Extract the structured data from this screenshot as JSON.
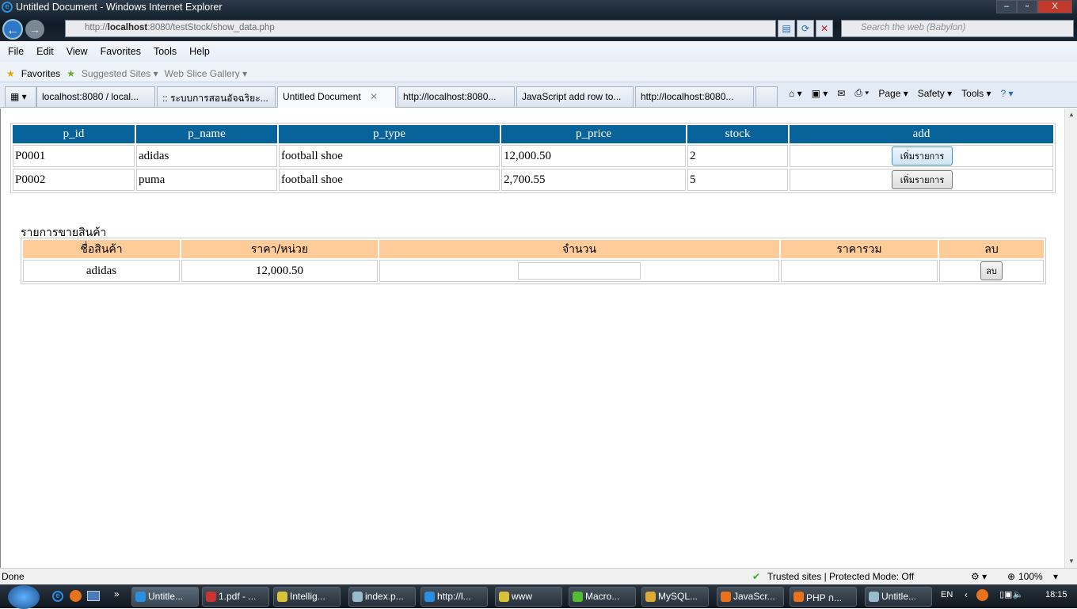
{
  "window": {
    "title": "Untitled Document - Windows Internet Explorer",
    "minimize": "–",
    "maximize": "▫",
    "close": "X"
  },
  "address": {
    "prefix": "http://",
    "host": "localhost",
    "rest": ":8080/testStock/show_data.php",
    "search_placeholder": "Search the web (Babylon)"
  },
  "menu": [
    "File",
    "Edit",
    "View",
    "Favorites",
    "Tools",
    "Help"
  ],
  "favorites": {
    "label": "Favorites",
    "suggested": "Suggested Sites ▾",
    "webslice": "Web Slice Gallery ▾"
  },
  "tabs": [
    "localhost:8080 / local...",
    ":: ระบบการสอนอัจฉริยะ...",
    "Untitled Document",
    "http://localhost:8080...",
    "JavaScript add row to...",
    "http://localhost:8080..."
  ],
  "command_bar": {
    "page": "Page ▾",
    "safety": "Safety ▾",
    "tools": "Tools ▾"
  },
  "products": {
    "headers": [
      "p_id",
      "p_name",
      "p_type",
      "p_price",
      "stock",
      "add"
    ],
    "rows": [
      {
        "p_id": "P0001",
        "p_name": "adidas",
        "p_type": "football shoe",
        "p_price": "12,000.50",
        "stock": "2",
        "button": "เพิ่มรายการ"
      },
      {
        "p_id": "P0002",
        "p_name": "puma",
        "p_type": "football shoe",
        "p_price": "2,700.55",
        "stock": "5",
        "button": "เพิ่มรายการ"
      }
    ]
  },
  "sales": {
    "caption": "รายการขายสินค้า",
    "headers": [
      "ชื่อสินค้า",
      "ราคา/หน่วย",
      "จำนวน",
      "ราคารวม",
      "ลบ"
    ],
    "rows": [
      {
        "name": "adidas",
        "unit_price": "12,000.50",
        "qty": "",
        "total": "",
        "delete": "ลบ"
      }
    ]
  },
  "status": {
    "text": "Done",
    "zone": "Trusted sites | Protected Mode: Off",
    "zoom": "100%"
  },
  "taskbar": {
    "items": [
      "Untitle...",
      "1.pdf - ...",
      "Intellig...",
      "index.p...",
      "http://l...",
      "www",
      "Macro...",
      "MySQL...",
      "JavaScr...",
      "PHP ก...",
      "Untitle..."
    ],
    "lang": "EN",
    "clock": "18:15"
  },
  "colors": {
    "header_blue": "#08639a",
    "header_orange": "#ffcc99"
  }
}
